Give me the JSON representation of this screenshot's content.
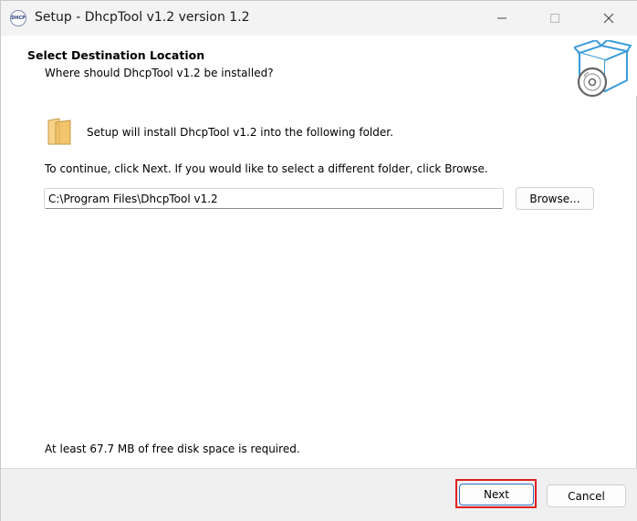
{
  "window": {
    "title": "Setup - DhcpTool v1.2 version 1.2",
    "app_icon_text": "DHCP"
  },
  "header": {
    "title": "Select Destination Location",
    "subtitle": "Where should DhcpTool v1.2 be installed?",
    "image_icon": "box-with-disc-icon"
  },
  "main": {
    "intro": "Setup will install DhcpTool v1.2 into the following folder.",
    "instructions": "To continue, click Next. If you would like to select a different folder, click Browse.",
    "folder_path": "C:\\Program Files\\DhcpTool v1.2",
    "browse_label": "Browse...",
    "disk_space": "At least 67.7 MB of free disk space is required."
  },
  "footer": {
    "next_label": "Next",
    "cancel_label": "Cancel"
  },
  "colors": {
    "accent": "#2b6fbf",
    "highlight": "#e02020",
    "icon_blue": "#3a9bd9",
    "folder": "#f2c46b"
  }
}
